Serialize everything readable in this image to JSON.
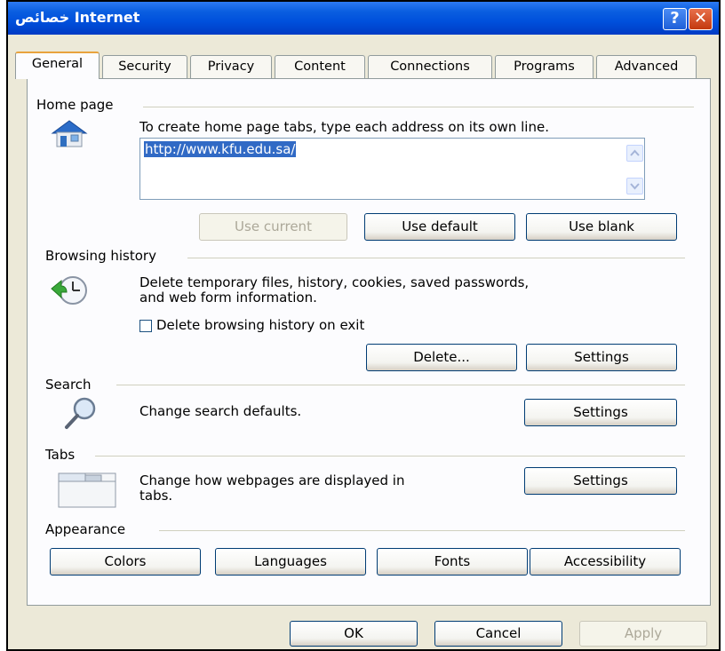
{
  "window": {
    "title": "خصائص Internet"
  },
  "tabs": [
    "General",
    "Security",
    "Privacy",
    "Content",
    "Connections",
    "Programs",
    "Advanced"
  ],
  "home_page": {
    "label": "Home page",
    "description": "To create home page tabs, type each address on its own line.",
    "url_value": "http://www.kfu.edu.sa/",
    "buttons": {
      "use_current": "Use current",
      "use_default": "Use default",
      "use_blank": "Use blank"
    }
  },
  "browsing_history": {
    "label": "Browsing history",
    "description_line1": "Delete temporary files, history, cookies, saved passwords,",
    "description_line2": "and web form information.",
    "checkbox_label": "Delete browsing history on exit",
    "checkbox_checked": false,
    "buttons": {
      "delete": "Delete...",
      "settings": "Settings"
    }
  },
  "search": {
    "label": "Search",
    "description": "Change search defaults.",
    "settings_button": "Settings"
  },
  "tabs_section": {
    "label": "Tabs",
    "description_line1": "Change how webpages are displayed in",
    "description_line2": "tabs.",
    "settings_button": "Settings"
  },
  "appearance": {
    "label": "Appearance",
    "buttons": {
      "colors": "Colors",
      "languages": "Languages",
      "fonts": "Fonts",
      "accessibility": "Accessibility"
    }
  },
  "footer": {
    "ok": "OK",
    "cancel": "Cancel",
    "apply": "Apply"
  },
  "colors": {
    "title_bar": "#0050dc",
    "selection": "#316ac5",
    "button_border": "#003c74",
    "close_button": "#c3390f"
  }
}
